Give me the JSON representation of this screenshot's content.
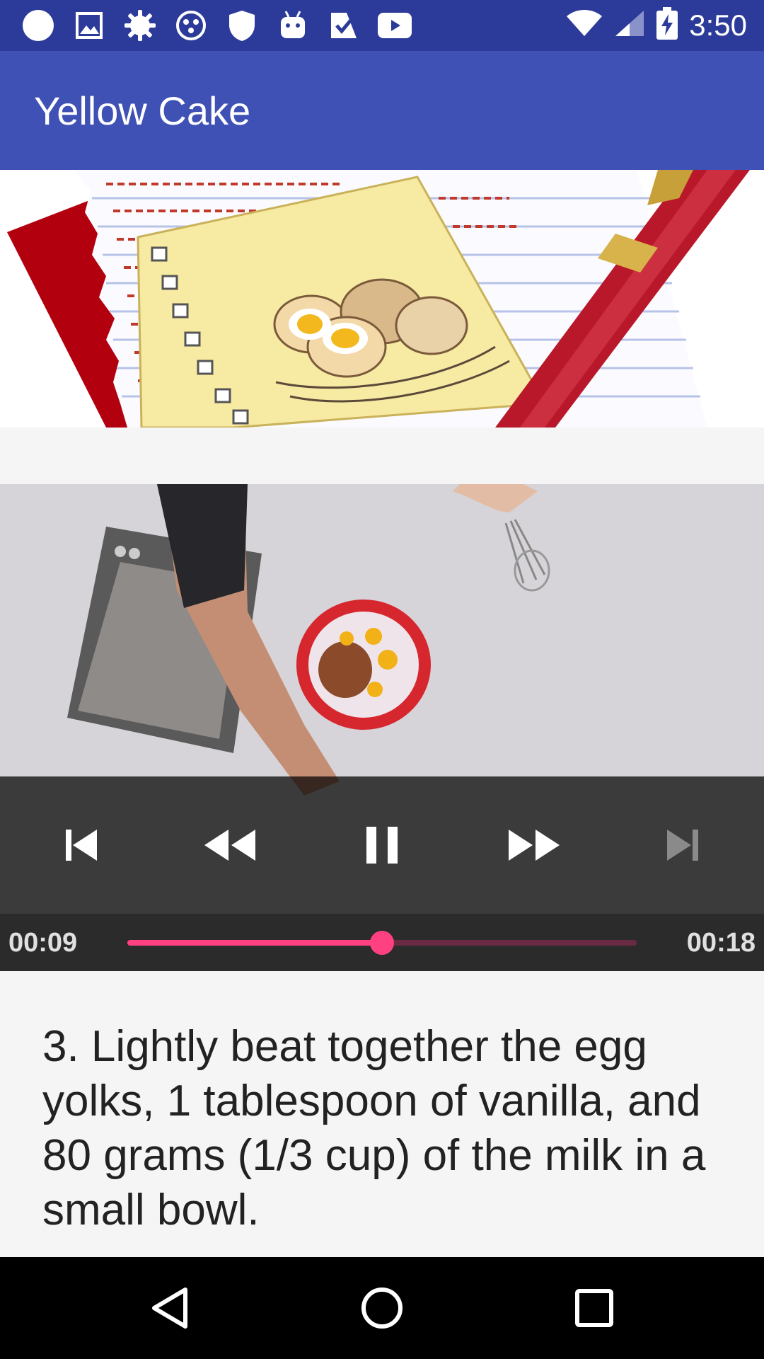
{
  "status_bar": {
    "time": "3:50",
    "left_icons": [
      "circle-notification-icon",
      "image-icon",
      "gear-notification-icon",
      "dots-icon",
      "shield-icon",
      "android-icon",
      "check-icon",
      "youtube-icon"
    ],
    "right_icons": [
      "wifi-icon",
      "signal-icon",
      "battery-charging-icon"
    ]
  },
  "app_bar": {
    "title": "Yellow Cake"
  },
  "player": {
    "current_time": "00:09",
    "total_time": "00:18",
    "progress": 0.5,
    "state": "playing"
  },
  "step": {
    "text": "3. Lightly beat together the egg yolks, 1 tablespoon of vanilla, and 80 grams (1/3 cup) of the milk in a small bowl."
  },
  "colors": {
    "status_bar": "#2c3b99",
    "app_bar": "#3f51b5",
    "accent": "#ff4081"
  }
}
